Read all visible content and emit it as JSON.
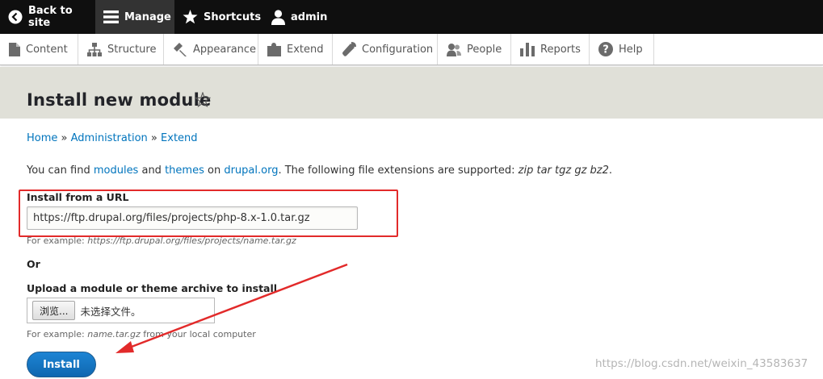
{
  "toolbar": {
    "back_label": "Back to site",
    "manage_label": "Manage",
    "shortcuts_label": "Shortcuts",
    "user_label": "admin"
  },
  "tray": {
    "items": [
      {
        "label": "Content",
        "icon": "file-icon"
      },
      {
        "label": "Structure",
        "icon": "sitemap-icon"
      },
      {
        "label": "Appearance",
        "icon": "paint-brush-icon"
      },
      {
        "label": "Extend",
        "icon": "puzzle-icon"
      },
      {
        "label": "Configuration",
        "icon": "wrench-icon"
      },
      {
        "label": "People",
        "icon": "people-icon"
      },
      {
        "label": "Reports",
        "icon": "bar-chart-icon"
      },
      {
        "label": "Help",
        "icon": "question-icon"
      }
    ]
  },
  "page": {
    "title": "Install new module"
  },
  "breadcrumb": {
    "home": "Home",
    "sep": "»",
    "administration": "Administration",
    "extend": "Extend"
  },
  "intro": {
    "t1": "You can find ",
    "modules": "modules",
    "t2": " and ",
    "themes": "themes",
    "t3": " on ",
    "drupal": "drupal.org",
    "t4": ". The following file extensions are supported: ",
    "extensions": "zip tar tgz gz bz2",
    "t5": "."
  },
  "form": {
    "url_label": "Install from a URL",
    "url_value": "https://ftp.drupal.org/files/projects/php-8.x-1.0.tar.gz",
    "url_example_prefix": "For example: ",
    "url_example": "https://ftp.drupal.org/files/projects/name.tar.gz",
    "or_label": "Or",
    "upload_label": "Upload a module or theme archive to install",
    "browse_label": "浏览...",
    "no_file_label": "未选择文件。",
    "upload_example_prefix": "For example: ",
    "upload_example": "name.tar.gz",
    "upload_example_suffix": " from your local computer",
    "install_label": "Install"
  },
  "watermark": "https://blog.csdn.net/weixin_43583637",
  "colors": {
    "toolbar_bg": "#0f0f0f",
    "link": "#0074bd",
    "install_button": "#1d84d4",
    "highlight_red": "#e22a2a",
    "header_bg": "#e0e0d8"
  }
}
